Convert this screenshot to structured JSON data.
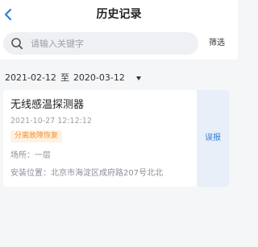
{
  "header": {
    "title": "历史记录",
    "back_icon": "chevron-left-icon",
    "accent_color": "#2f7fd8"
  },
  "search": {
    "placeholder": "请输入关键字",
    "value": "",
    "icon": "search-icon",
    "filter_label": "筛选"
  },
  "date_range": {
    "start": "2021-02-12",
    "separator": "至",
    "end": "2020-03-12",
    "icon": "caret-down-icon"
  },
  "records": [
    {
      "device_name": "无线感温探测器",
      "time": "2021-10-27 12:12:12",
      "status_tag": "分离故障恢复",
      "status_color": "#f2922f",
      "location": "场所：一层",
      "address": "安装位置：北京市海淀区成府路207号北北",
      "action_label": "误报"
    }
  ]
}
